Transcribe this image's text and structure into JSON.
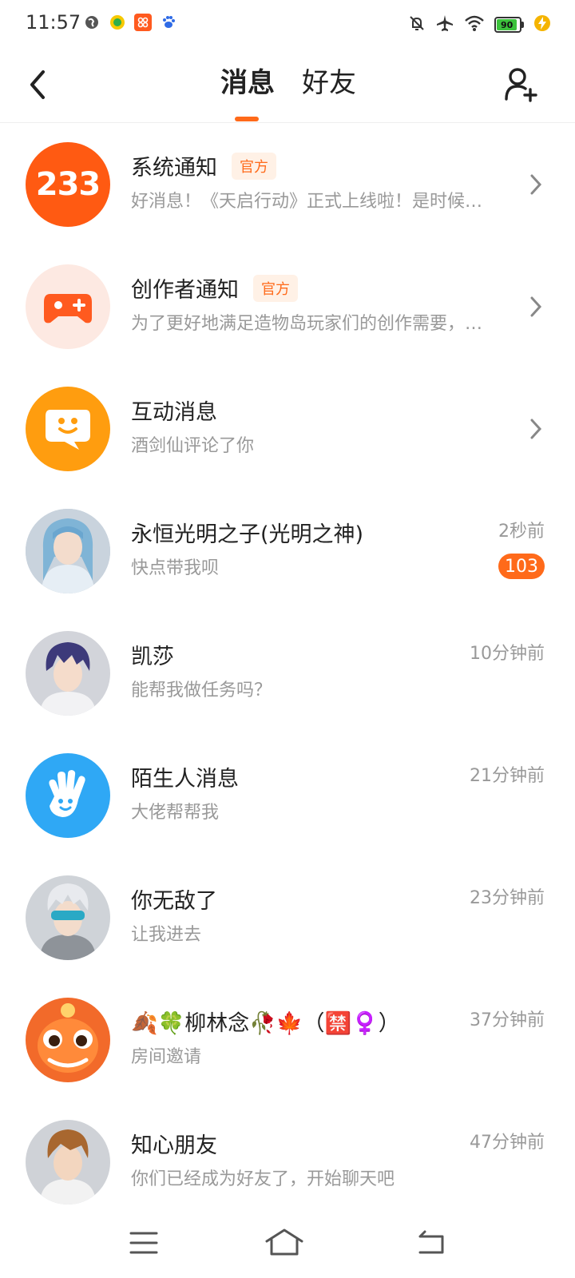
{
  "status_bar": {
    "time": "11:57",
    "battery": "90",
    "icons": [
      "globe-icon",
      "mini-app-icon",
      "store-icon",
      "baidu-icon",
      "mute-bell-icon",
      "airplane-icon",
      "wifi-icon",
      "battery-icon",
      "charging-icon"
    ]
  },
  "header": {
    "tabs": [
      {
        "label": "消息",
        "active": true
      },
      {
        "label": "好友",
        "active": false
      }
    ]
  },
  "colors": {
    "accent": "#ff6a1a",
    "muted_text": "#999999",
    "title_text": "#222222"
  },
  "conversations": [
    {
      "title": "系统通知",
      "badge": "官方",
      "preview": "好消息！《天启行动》正式上线啦！是时候…",
      "logo_text": "233"
    },
    {
      "title": "创作者通知",
      "badge": "官方",
      "preview": "为了更好地满足造物岛玩家们的创作需要，…"
    },
    {
      "title": "互动消息",
      "preview": "酒剑仙评论了你"
    },
    {
      "title": "永恒光明之子(光明之神)",
      "preview": "快点带我呗",
      "time": "2秒前",
      "unread": "103"
    },
    {
      "title": "凯莎",
      "preview": "能帮我做任务吗？",
      "time": "10分钟前"
    },
    {
      "title": "陌生人消息",
      "preview": "大佬帮帮我",
      "time": "21分钟前"
    },
    {
      "title": "你无敌了",
      "preview": "让我进去",
      "time": "23分钟前"
    },
    {
      "title": "🍂🍀柳林念🥀🍁（🈲♀️）",
      "preview": "房间邀请",
      "time": "37分钟前"
    },
    {
      "title": "知心朋友",
      "preview": "你们已经成为好友了，开始聊天吧",
      "time": "47分钟前"
    }
  ]
}
